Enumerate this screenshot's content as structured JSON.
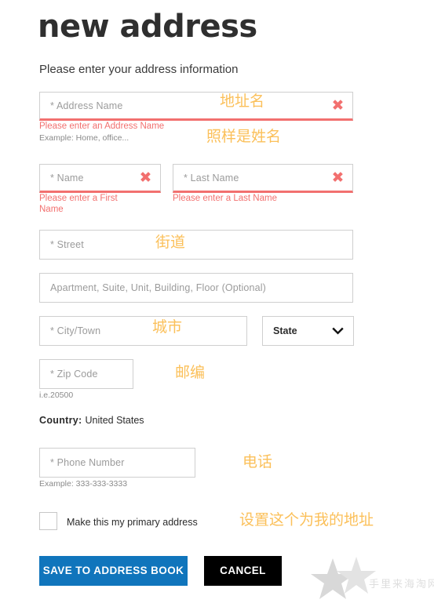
{
  "header": {
    "title": "new address",
    "subtitle": "Please enter your address information"
  },
  "form": {
    "address_name": {
      "placeholder": "* Address Name",
      "value": "",
      "error": "Please enter an Address Name",
      "hint": "Example: Home, office...",
      "clear_icon": "✖"
    },
    "first_name": {
      "placeholder": "* Name",
      "value": "",
      "error": "Please enter a First\nName",
      "clear_icon": "✖"
    },
    "last_name": {
      "placeholder": "* Last Name",
      "value": "",
      "error": "Please enter a Last Name",
      "clear_icon": "✖"
    },
    "street": {
      "placeholder": "* Street",
      "value": ""
    },
    "apartment": {
      "placeholder": "Apartment, Suite, Unit, Building, Floor (Optional)",
      "value": ""
    },
    "city": {
      "placeholder": "* City/Town",
      "value": ""
    },
    "state": {
      "selected": "State",
      "chevron_icon": "chevron-down-icon"
    },
    "zip": {
      "placeholder": "* Zip Code",
      "value": "",
      "hint": "i.e.20500"
    },
    "country": {
      "label": "Country:",
      "value": "United States"
    },
    "phone": {
      "placeholder": "* Phone Number",
      "value": "",
      "hint": "Example: 333-333-3333"
    },
    "primary_checkbox": {
      "label": "Make this my primary address",
      "checked": false
    }
  },
  "actions": {
    "save_label": "SAVE TO ADDRESS BOOK",
    "cancel_label": "CANCEL"
  },
  "annotations": {
    "address_name": "地址名",
    "address_name_note": "照样是姓名",
    "street": "街道",
    "city": "城市",
    "zip": "邮编",
    "phone": "电话",
    "primary": "设置这个为我的地址"
  },
  "watermark": {
    "text": "手里来海淘网"
  },
  "colors": {
    "error": "#f2706f",
    "annotation": "#fbc05a",
    "save_button": "#1075bc",
    "cancel_button": "#000000",
    "placeholder": "#9b9b9b",
    "border": "#cfcfcf"
  }
}
